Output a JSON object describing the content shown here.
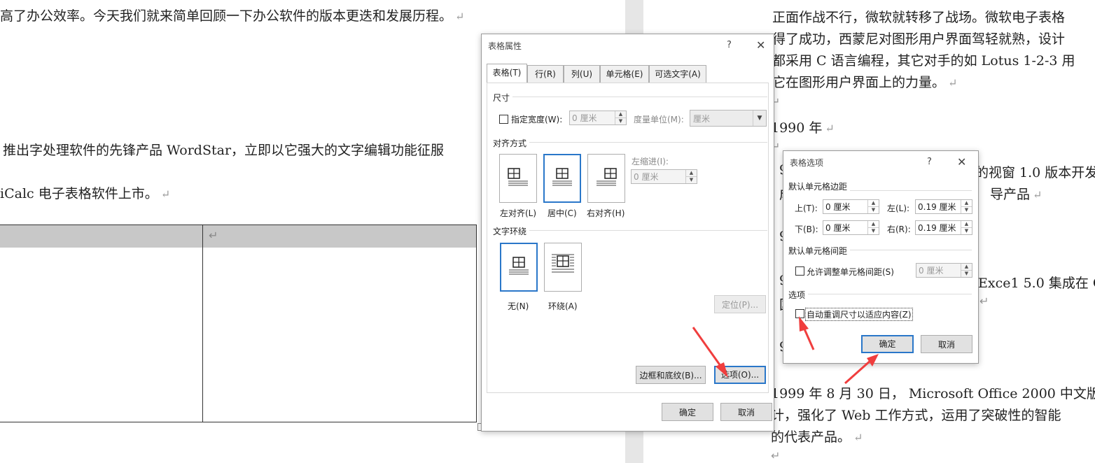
{
  "document": {
    "left_lines": [
      "高了办公效率。今天我们就来简单回顾一下办公软件的版本更迭和发展历程。",
      "推出字处理软件的先锋产品 WordStar，立即以它强大的文字编辑功能征服",
      "iCalc 电子表格软件上市。"
    ],
    "right_lines": [
      "正面作战不行，微软就转移了战场。微软电子表格",
      "得了成功，西蒙尼对图形用户界面驾轻就熟，设计",
      "都采用 C 语言编程，其它对手的如 Lotus 1-2-3 用",
      "它在图形用户界面上的力量。",
      "1990 年",
      "9",
      "的视窗 1.0 版本开发",
      "成",
      "导产品",
      "9",
      "9",
      "Exce1 5.0 集成在 C",
      "国",
      "9",
      "1999 年 8 月 30 日， Microsoft Office 2000 中文版",
      "计，强化了 Web 工作方式，运用了突破性的智能",
      "的代表产品。"
    ],
    "paragraph_mark": "↵"
  },
  "table_props": {
    "title": "表格属性",
    "help": "?",
    "close": "✕",
    "tabs": [
      "表格(T)",
      "行(R)",
      "列(U)",
      "单元格(E)",
      "可选文字(A)"
    ],
    "size_section": "尺寸",
    "specify_width_label": "指定宽度(W):",
    "width_value": "0 厘米",
    "measure_label": "度量单位(M):",
    "measure_value": "厘米",
    "align_section": "对齐方式",
    "align_left": "左对齐(L)",
    "align_center": "居中(C)",
    "align_right": "右对齐(H)",
    "indent_label": "左缩进(I):",
    "indent_value": "0 厘米",
    "wrap_section": "文字环绕",
    "wrap_none": "无(N)",
    "wrap_around": "环绕(A)",
    "position_button": "定位(P)...",
    "borders_button": "边框和底纹(B)...",
    "options_button": "选项(O)...",
    "ok": "确定",
    "cancel": "取消"
  },
  "table_options": {
    "title": "表格选项",
    "help": "?",
    "close": "✕",
    "margins_section": "默认单元格边距",
    "top_label": "上(T):",
    "top_value": "0 厘米",
    "left_label": "左(L):",
    "left_value": "0.19 厘米",
    "bottom_label": "下(B):",
    "bottom_value": "0 厘米",
    "right_label": "右(R):",
    "right_value": "0.19 厘米",
    "spacing_section": "默认单元格间距",
    "allow_spacing_label": "允许调整单元格间距(S)",
    "spacing_value": "0 厘米",
    "options_section": "选项",
    "autofit_label": "自动重调尺寸以适应内容(Z)",
    "ok": "确定",
    "cancel": "取消"
  },
  "colors": {
    "accent": "#2a77c9",
    "arrow": "#f03e3e"
  }
}
